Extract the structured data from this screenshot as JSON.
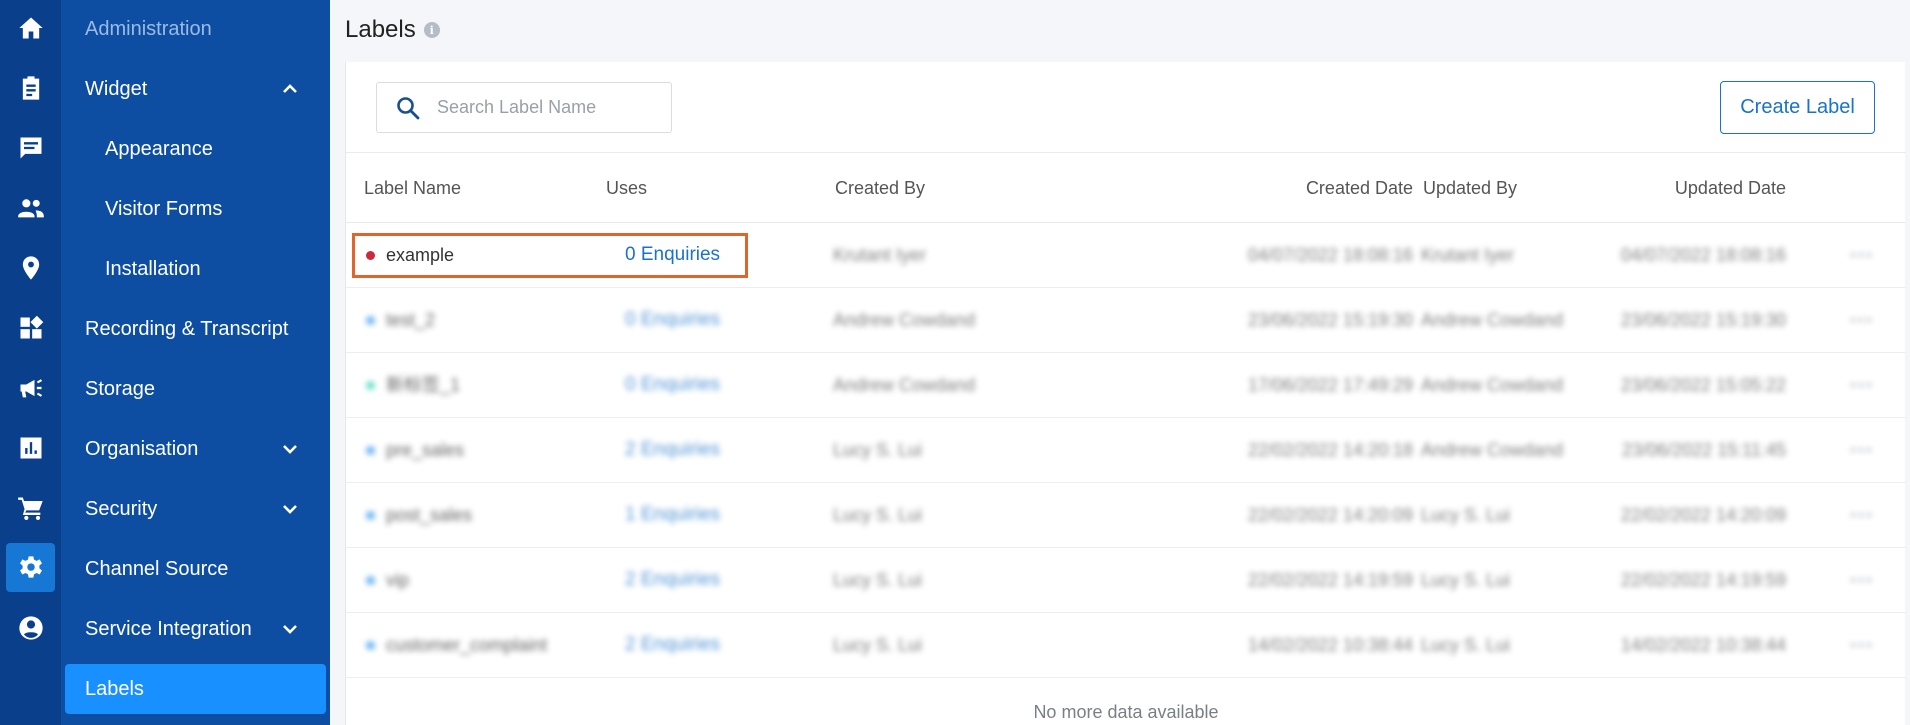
{
  "sidebar": {
    "items": [
      {
        "label": "Administration"
      },
      {
        "label": "Widget"
      },
      {
        "label": "Appearance"
      },
      {
        "label": "Visitor Forms"
      },
      {
        "label": "Installation"
      },
      {
        "label": "Recording & Transcript"
      },
      {
        "label": "Storage"
      },
      {
        "label": "Organisation"
      },
      {
        "label": "Security"
      },
      {
        "label": "Channel Source"
      },
      {
        "label": "Service Integration"
      },
      {
        "label": "Labels"
      }
    ]
  },
  "page": {
    "title": "Labels"
  },
  "search": {
    "placeholder": "Search Label Name"
  },
  "actions": {
    "create_label": "Create Label"
  },
  "table": {
    "columns": [
      "Label Name",
      "Uses",
      "Created By",
      "Created Date",
      "Updated By",
      "Updated Date"
    ],
    "rows": [
      {
        "name": "example",
        "uses": "0 Enquiries",
        "created_by": "Krutant Iyer",
        "created_date": "04/07/2022  18:08:16",
        "updated_by": "Krutant Iyer",
        "updated_date": "04/07/2022  18:08:16",
        "color": "#d0283a"
      },
      {
        "name": "test_2",
        "uses": "0 Enquiries",
        "created_by": "Andrew Cowdand",
        "created_date": "23/06/2022  15:19:30",
        "updated_by": "Andrew Cowdand",
        "updated_date": "23/06/2022  15:19:30",
        "color": "#3a9cf0"
      },
      {
        "name": "新标签_1",
        "uses": "0 Enquiries",
        "created_by": "Andrew Cowdand",
        "created_date": "17/06/2022  17:49:29",
        "updated_by": "Andrew Cowdand",
        "updated_date": "23/06/2022  15:05:22",
        "color": "#3ad3b8"
      },
      {
        "name": "pre_sales",
        "uses": "2 Enquiries",
        "created_by": "Lucy S. Lui",
        "created_date": "22/02/2022  14:20:18",
        "updated_by": "Andrew Cowdand",
        "updated_date": "23/06/2022  15:11:45",
        "color": "#3a9cf0"
      },
      {
        "name": "post_sales",
        "uses": "1 Enquiries",
        "created_by": "Lucy S. Lui",
        "created_date": "22/02/2022  14:20:09",
        "updated_by": "Lucy S. Lui",
        "updated_date": "22/02/2022  14:20:09",
        "color": "#3a9cf0"
      },
      {
        "name": "vip",
        "uses": "2 Enquiries",
        "created_by": "Lucy S. Lui",
        "created_date": "22/02/2022  14:19:59",
        "updated_by": "Lucy S. Lui",
        "updated_date": "22/02/2022  14:19:59",
        "color": "#3a9cf0"
      },
      {
        "name": "customer_complaint",
        "uses": "2 Enquiries",
        "created_by": "Lucy S. Lui",
        "created_date": "14/02/2022  10:38:44",
        "updated_by": "Lucy S. Lui",
        "updated_date": "14/02/2022  10:38:44",
        "color": "#3a9cf0"
      }
    ],
    "footer": "No more data available"
  }
}
